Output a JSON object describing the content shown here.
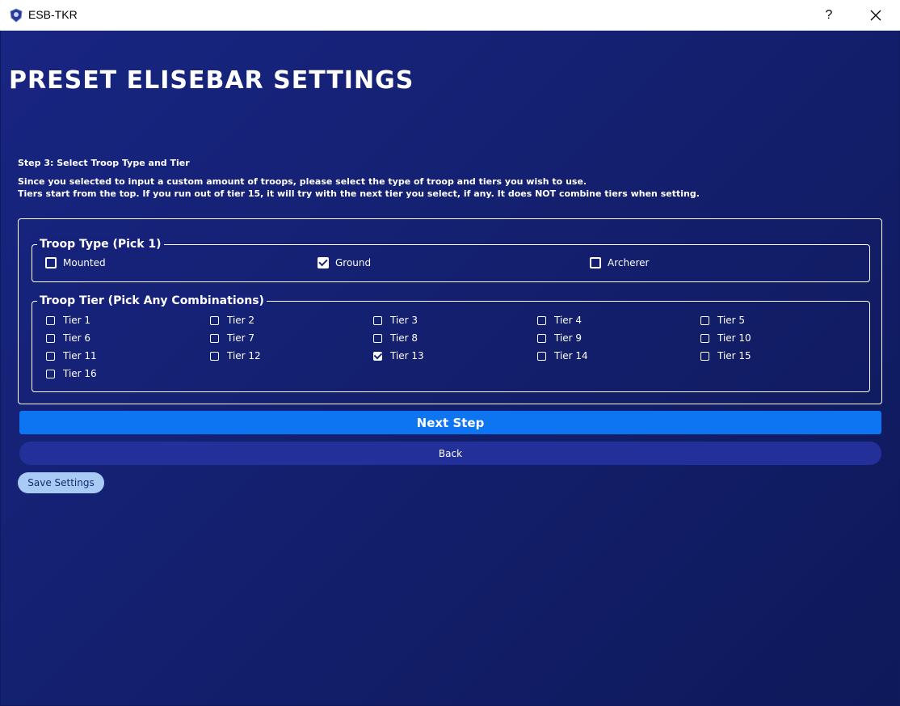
{
  "window": {
    "title": "ESB-TKR",
    "help_label": "?",
    "icon": "app-logo-icon",
    "close_icon": "close-icon"
  },
  "page": {
    "title": "PRESET ELISEBAR SETTINGS",
    "step_title": "Step 3: Select Troop Type and Tier",
    "description_lines": [
      "Since you selected to input a custom amount of troops, please select the type of troop and tiers you wish to use.",
      "Tiers start from the top. If you run out of tier 15, it will try with the next tier you select, if any. It does NOT combine tiers when setting."
    ]
  },
  "troop_type": {
    "legend": "Troop Type (Pick 1)",
    "options": [
      {
        "label": "Mounted",
        "checked": false
      },
      {
        "label": "Ground",
        "checked": true
      },
      {
        "label": "Archerer",
        "checked": false
      }
    ]
  },
  "troop_tier": {
    "legend": "Troop Tier (Pick Any Combinations)",
    "options": [
      {
        "label": "Tier 1",
        "checked": false
      },
      {
        "label": "Tier 2",
        "checked": false
      },
      {
        "label": "Tier 3",
        "checked": false
      },
      {
        "label": "Tier 4",
        "checked": false
      },
      {
        "label": "Tier 5",
        "checked": false
      },
      {
        "label": "Tier 6",
        "checked": false
      },
      {
        "label": "Tier 7",
        "checked": false
      },
      {
        "label": "Tier 8",
        "checked": false
      },
      {
        "label": "Tier 9",
        "checked": false
      },
      {
        "label": "Tier 10",
        "checked": false
      },
      {
        "label": "Tier 11",
        "checked": false
      },
      {
        "label": "Tier 12",
        "checked": false
      },
      {
        "label": "Tier 13",
        "checked": true
      },
      {
        "label": "Tier 14",
        "checked": false
      },
      {
        "label": "Tier 15",
        "checked": false
      },
      {
        "label": "Tier 16",
        "checked": false
      }
    ]
  },
  "buttons": {
    "next": "Next Step",
    "back": "Back",
    "save": "Save Settings"
  },
  "colors": {
    "background": "#16227a",
    "next_button": "#0d74f2",
    "back_button": "#23309a",
    "save_button": "#a7cbf5"
  }
}
